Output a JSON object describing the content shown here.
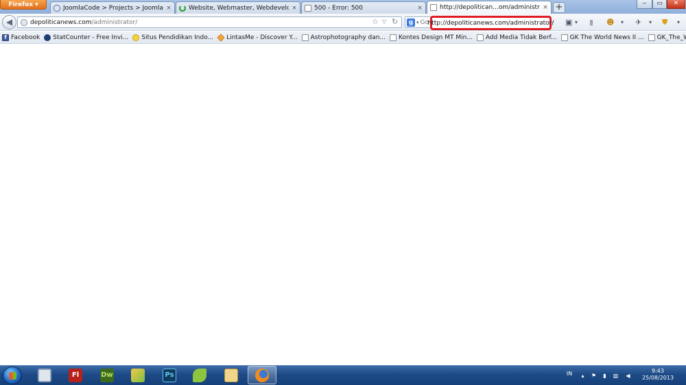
{
  "browser": {
    "menu_button": "Firefox",
    "tabs": [
      {
        "title": "JoomlaCode > Projects > Joomla! > R...",
        "close": "×"
      },
      {
        "title": "Website, Webmaster, Webdeveloper |...",
        "close": "×"
      },
      {
        "title": "500 - Error: 500",
        "close": "×"
      },
      {
        "title": "http://depolitican...om/administrator/",
        "close": "×",
        "active": true
      }
    ],
    "new_tab": "+",
    "window_controls": {
      "minimize": "‒",
      "maximize": "▭",
      "close": "✕"
    }
  },
  "navbar": {
    "url_domain": "depoliticanews.com",
    "url_path": "/administrator/",
    "search_text": "Go",
    "tooltip_url": "http://depoliticanews.com/administrator/"
  },
  "bookmarks": [
    {
      "label": "Facebook",
      "icon": "facebook-icon"
    },
    {
      "label": "StatCounter - Free Invi...",
      "icon": "statcounter-icon"
    },
    {
      "label": "Situs Pendidikan Indo...",
      "icon": "smiley-icon"
    },
    {
      "label": "LintasMe - Discover Y...",
      "icon": "diamond-icon"
    },
    {
      "label": "Astrophotography dan...",
      "icon": "page-icon"
    },
    {
      "label": "Kontes Design MT Min...",
      "icon": "page-icon"
    },
    {
      "label": "Add Media Tidak Berf...",
      "icon": "page-icon"
    },
    {
      "label": "GK The World News II ...",
      "icon": "page-icon"
    },
    {
      "label": "GK_The_World_News_I...",
      "icon": "page-icon"
    }
  ],
  "taskbar": {
    "apps": [
      {
        "name": "explorer-window",
        "label": ""
      },
      {
        "name": "flash",
        "label": "Fl"
      },
      {
        "name": "dreamweaver",
        "label": "Dw"
      },
      {
        "name": "paint-app",
        "label": ""
      },
      {
        "name": "photoshop",
        "label": "Ps"
      },
      {
        "name": "corel-app",
        "label": ""
      },
      {
        "name": "file-manager",
        "label": ""
      },
      {
        "name": "firefox",
        "label": ""
      }
    ],
    "language": "IN",
    "time": "9:43",
    "date": "25/08/2013"
  }
}
